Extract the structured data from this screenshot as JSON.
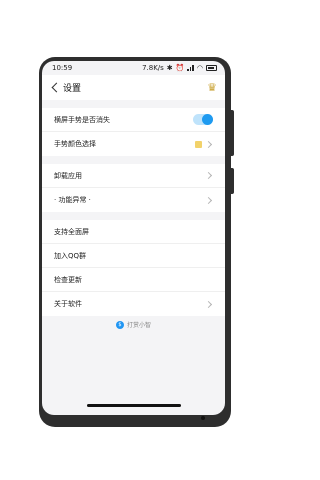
{
  "status": {
    "time": "10:59",
    "speed": "7.8K/s"
  },
  "header": {
    "title": "设置"
  },
  "groups": [
    {
      "items": [
        {
          "label": "横屏手势是否消失"
        },
        {
          "label": "手势颜色选择"
        }
      ]
    },
    {
      "items": [
        {
          "label": "卸载应用"
        },
        {
          "label": "· 功能异常 ·"
        }
      ]
    },
    {
      "items": [
        {
          "label": "支持全面屏"
        },
        {
          "label": "加入QQ群"
        },
        {
          "label": "检查更新"
        },
        {
          "label": "关于软件"
        }
      ]
    }
  ],
  "footer": {
    "tip_label": "打赏小智",
    "tip_icon_glyph": "$"
  },
  "colors": {
    "accent": "#1e9af0",
    "swatch": "#f2d26a",
    "crown": "#c9a233"
  },
  "icons": [
    "back-arrow-icon",
    "crown-icon",
    "chevron-right-icon",
    "bluetooth-icon",
    "wifi-icon",
    "battery-icon"
  ],
  "toggles": {
    "gesture_hide": true
  }
}
